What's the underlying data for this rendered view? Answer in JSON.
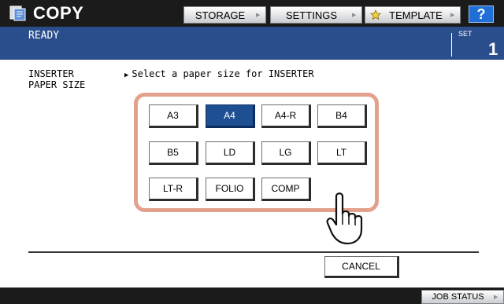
{
  "header": {
    "title": "COPY",
    "app_icon": "copy-icon",
    "buttons": {
      "storage": "STORAGE",
      "settings": "SETTINGS",
      "template": "TEMPLATE",
      "template_icon": "star-icon",
      "help": "?"
    }
  },
  "status": {
    "text": "READY",
    "set_label": "SET",
    "set_value": "1"
  },
  "main": {
    "label_line1": "INSERTER",
    "label_line2": "PAPER SIZE",
    "instruction": "Select a paper size for INSERTER",
    "selected_size": "A4",
    "sizes": [
      "A3",
      "A4",
      "A4-R",
      "B4",
      "B5",
      "LD",
      "LG",
      "LT",
      "LT-R",
      "FOLIO",
      "COMP"
    ],
    "cancel": "CANCEL"
  },
  "footer": {
    "job_status": "JOB STATUS"
  },
  "colors": {
    "topbar": "#1b1b1b",
    "statusbar": "#2a4e8c",
    "selected": "#1f4f93",
    "highlight": "#e3a18c",
    "help": "#1f6fd6"
  }
}
